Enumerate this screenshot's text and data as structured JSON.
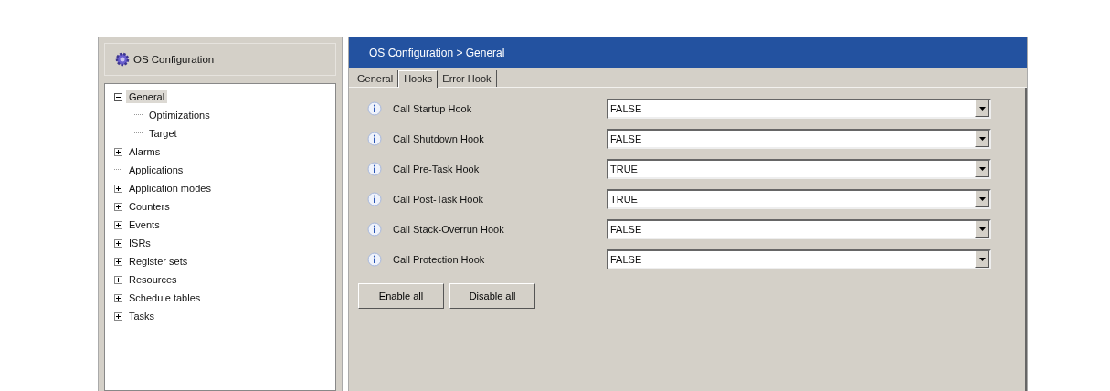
{
  "sidebar": {
    "title": "OS Configuration",
    "tree": [
      {
        "label": "General",
        "kind": "group",
        "expanded": true,
        "selected": true,
        "children": [
          {
            "label": "Optimizations",
            "kind": "leaf",
            "selected": false
          },
          {
            "label": "Target",
            "kind": "leaf",
            "selected": false
          }
        ]
      },
      {
        "label": "Alarms",
        "kind": "group",
        "expanded": false,
        "selected": false
      },
      {
        "label": "Applications",
        "kind": "leaf",
        "selected": false
      },
      {
        "label": "Application modes",
        "kind": "group",
        "expanded": false,
        "selected": false
      },
      {
        "label": "Counters",
        "kind": "group",
        "expanded": false,
        "selected": false
      },
      {
        "label": "Events",
        "kind": "group",
        "expanded": false,
        "selected": false
      },
      {
        "label": "ISRs",
        "kind": "group",
        "expanded": false,
        "selected": false
      },
      {
        "label": "Register sets",
        "kind": "group",
        "expanded": false,
        "selected": false
      },
      {
        "label": "Resources",
        "kind": "group",
        "expanded": false,
        "selected": false
      },
      {
        "label": "Schedule tables",
        "kind": "group",
        "expanded": false,
        "selected": false
      },
      {
        "label": "Tasks",
        "kind": "group",
        "expanded": false,
        "selected": false
      }
    ]
  },
  "panel": {
    "title": "OS Configuration  >  General",
    "tabs": [
      {
        "label": "General",
        "selected": false
      },
      {
        "label": "Hooks",
        "selected": true
      },
      {
        "label": "Error Hook",
        "selected": false
      }
    ],
    "settings": [
      {
        "label": "Call Startup Hook",
        "value": "FALSE"
      },
      {
        "label": "Call Shutdown Hook",
        "value": "FALSE"
      },
      {
        "label": "Call Pre-Task Hook",
        "value": "TRUE"
      },
      {
        "label": "Call Post-Task Hook",
        "value": "TRUE"
      },
      {
        "label": "Call Stack-Overrun Hook",
        "value": "FALSE"
      },
      {
        "label": "Call Protection Hook",
        "value": "FALSE"
      }
    ],
    "buttons": [
      "Enable all",
      "Disable all"
    ]
  }
}
